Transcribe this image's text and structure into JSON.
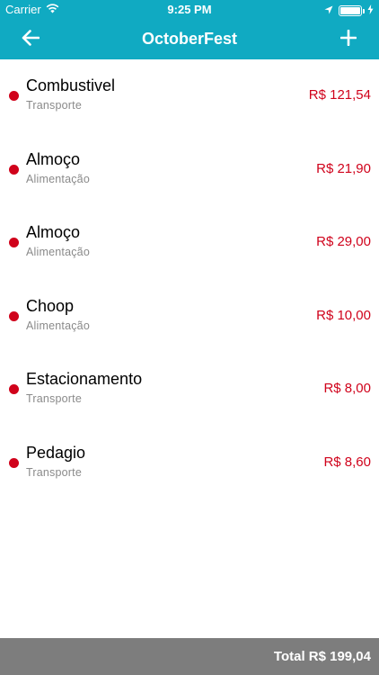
{
  "status_bar": {
    "carrier": "Carrier",
    "time": "9:25 PM",
    "icons": [
      "wifi-icon",
      "location-arrow-icon",
      "battery-icon",
      "charging-bolt-icon"
    ]
  },
  "nav": {
    "title": "OctoberFest",
    "back_icon": "arrow-left-icon",
    "add_icon": "plus-icon"
  },
  "expenses": [
    {
      "name": "Combustivel",
      "category": "Transporte",
      "amount": "R$ 121,54"
    },
    {
      "name": "Almoço",
      "category": "Alimentação",
      "amount": "R$ 21,90"
    },
    {
      "name": "Almoço",
      "category": "Alimentação",
      "amount": "R$ 29,00"
    },
    {
      "name": "Choop",
      "category": "Alimentação",
      "amount": "R$ 10,00"
    },
    {
      "name": "Estacionamento",
      "category": "Transporte",
      "amount": "R$ 8,00"
    },
    {
      "name": "Pedagio",
      "category": "Transporte",
      "amount": "R$ 8,60"
    }
  ],
  "footer": {
    "total": "Total R$ 199,04"
  },
  "colors": {
    "accent": "#10aac2",
    "amount": "#d0021b",
    "footer": "#7d7d7d"
  }
}
